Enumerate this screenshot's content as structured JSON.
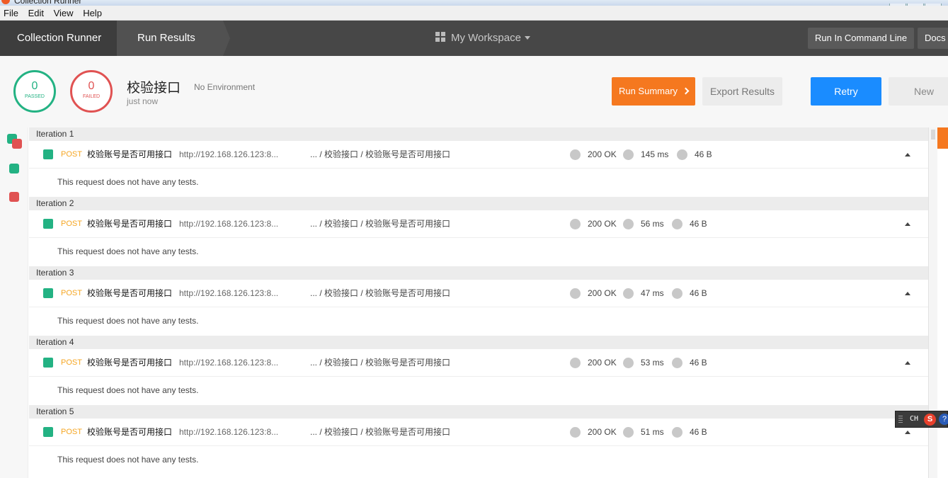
{
  "window": {
    "title": "Collection Runner"
  },
  "menu": [
    "File",
    "Edit",
    "View",
    "Help"
  ],
  "header": {
    "crumbs": [
      "Collection Runner",
      "Run Results"
    ],
    "workspace": "My Workspace",
    "run_cmd": "Run In Command Line",
    "docs": "Docs"
  },
  "summary": {
    "passed_count": "0",
    "passed_label": "PASSED",
    "failed_count": "0",
    "failed_label": "FAILED",
    "collection": "校验接口",
    "environment": "No Environment",
    "time": "just now",
    "run_summary": "Run Summary",
    "export": "Export Results",
    "retry": "Retry",
    "new": "New"
  },
  "colors": {
    "pass": "#23b283",
    "fail": "#e05252",
    "accent": "#f5781f",
    "primary": "#1a8cff"
  },
  "no_tests": "This request does not have any tests.",
  "iterations": [
    {
      "label": "Iteration 1",
      "method": "POST",
      "name": "校验账号是否可用接口",
      "url": "http://192.168.126.123:8...",
      "path": "... / 校验接口 / 校验账号是否可用接口",
      "status": "200 OK",
      "time": "145 ms",
      "size": "46 B"
    },
    {
      "label": "Iteration 2",
      "method": "POST",
      "name": "校验账号是否可用接口",
      "url": "http://192.168.126.123:8...",
      "path": "... / 校验接口 / 校验账号是否可用接口",
      "status": "200 OK",
      "time": "56 ms",
      "size": "46 B"
    },
    {
      "label": "Iteration 3",
      "method": "POST",
      "name": "校验账号是否可用接口",
      "url": "http://192.168.126.123:8...",
      "path": "... / 校验接口 / 校验账号是否可用接口",
      "status": "200 OK",
      "time": "47 ms",
      "size": "46 B"
    },
    {
      "label": "Iteration 4",
      "method": "POST",
      "name": "校验账号是否可用接口",
      "url": "http://192.168.126.123:8...",
      "path": "... / 校验接口 / 校验账号是否可用接口",
      "status": "200 OK",
      "time": "53 ms",
      "size": "46 B"
    },
    {
      "label": "Iteration 5",
      "method": "POST",
      "name": "校验账号是否可用接口",
      "url": "http://192.168.126.123:8...",
      "path": "... / 校验接口 / 校验账号是否可用接口",
      "status": "200 OK",
      "time": "51 ms",
      "size": "46 B"
    }
  ],
  "ime": {
    "lang": "CH",
    "logo": "S",
    "help": "?"
  }
}
